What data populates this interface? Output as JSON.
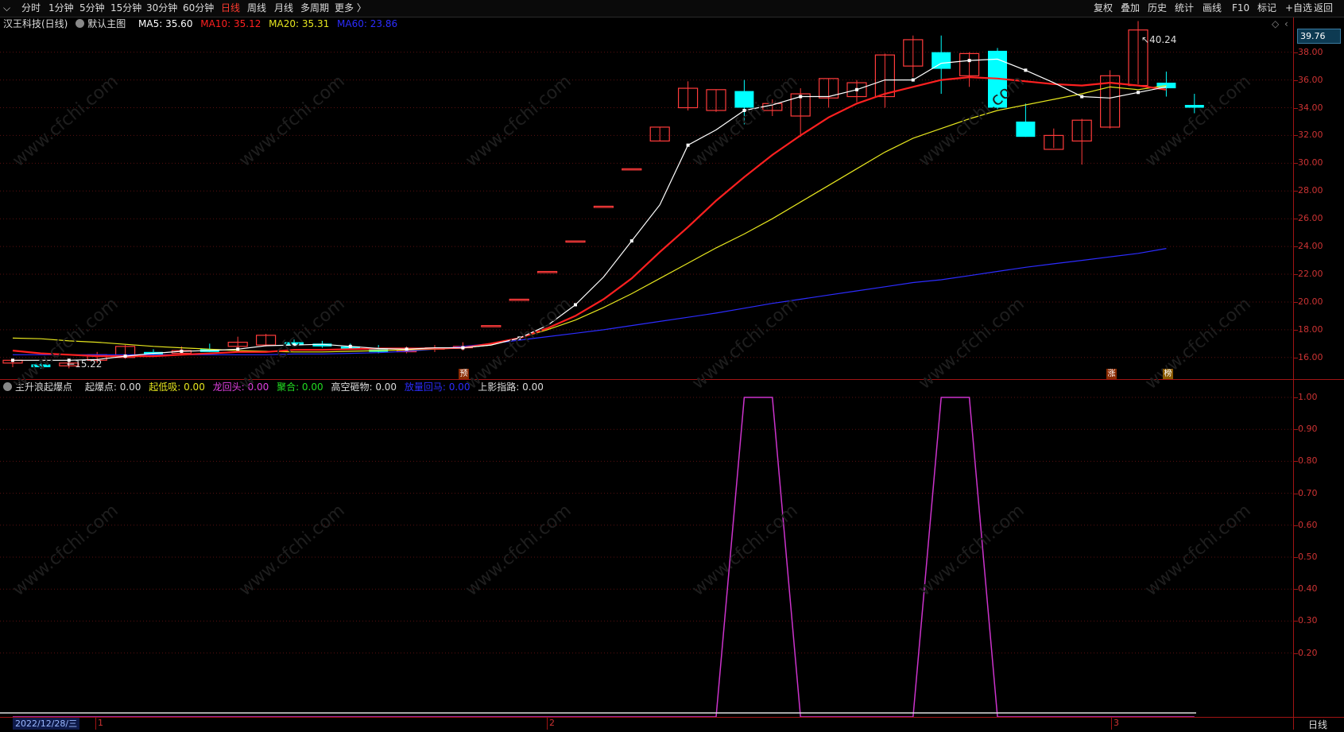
{
  "topbar": {
    "left_items": [
      "分时",
      "1分钟",
      "5分钟",
      "15分钟",
      "30分钟",
      "60分钟",
      "日线",
      "周线",
      "月线",
      "多周期",
      "更多 〉"
    ],
    "active_index": 6,
    "right_items": [
      "复权",
      "叠加",
      "历史",
      "统计",
      "画线",
      "F10",
      "标记",
      "+自选",
      "返回"
    ]
  },
  "main_legend": {
    "stock": "汉王科技(日线)",
    "template": "默认主图",
    "ma5": "MA5: 35.60",
    "ma10": "MA10: 35.12",
    "ma20": "MA20: 35.31",
    "ma60": "MA60: 23.86"
  },
  "indicator_legend": {
    "name": "主升浪起爆点",
    "items": [
      "起爆点: 0.00",
      "起低吸: 0.00",
      "龙回头: 0.00",
      "聚合: 0.00",
      "高空砸物: 0.00",
      "放量回马: 0.00",
      "上影指路: 0.00"
    ]
  },
  "colors": {
    "ma5": "#ffffff",
    "ma10": "#ff2020",
    "ma20": "#e6e61e",
    "ma60": "#2c2cff",
    "up": "#ff3b3b",
    "down": "#00ffff",
    "indicator": "#cc33cc",
    "grid": "#a01414"
  },
  "price_axis": {
    "current": "39.76",
    "ticks": [
      "38.00",
      "36.00",
      "34.00",
      "32.00",
      "30.00",
      "28.00",
      "26.00",
      "24.00",
      "22.00",
      "20.00",
      "18.00",
      "16.00"
    ]
  },
  "indicator_axis": {
    "ticks": [
      "1.00",
      "0.90",
      "0.80",
      "0.70",
      "0.60",
      "0.50",
      "0.40",
      "0.30",
      "0.20"
    ]
  },
  "annotations": {
    "high": "40.24",
    "low": "15.22",
    "badge_yu": "预",
    "badge_zhang": "涨",
    "badge_bang": "榜"
  },
  "bottom": {
    "date": "2022/12/28/三",
    "marks": [
      "1",
      "2",
      "3"
    ],
    "period": "日线"
  },
  "watermark": "www.cfchi.com",
  "chart_data": {
    "type": "candlestick",
    "ylim": [
      14.5,
      40.5
    ],
    "ohlc": [
      [
        15.6,
        15.9,
        15.3,
        15.8
      ],
      [
        15.5,
        15.8,
        15.2,
        15.3
      ],
      [
        15.4,
        15.7,
        15.22,
        15.6
      ],
      [
        15.8,
        16.4,
        15.6,
        16.2
      ],
      [
        16.0,
        16.9,
        15.9,
        16.8
      ],
      [
        16.4,
        16.6,
        16.1,
        16.2
      ],
      [
        16.3,
        16.8,
        16.2,
        16.5
      ],
      [
        16.6,
        17.0,
        16.4,
        16.4
      ],
      [
        16.8,
        17.5,
        16.6,
        17.1
      ],
      [
        16.9,
        17.7,
        16.8,
        17.6
      ],
      [
        17.1,
        17.3,
        16.8,
        16.9
      ],
      [
        17.0,
        17.2,
        16.7,
        16.8
      ],
      [
        16.8,
        17.0,
        16.6,
        16.6
      ],
      [
        16.6,
        16.9,
        16.3,
        16.4
      ],
      [
        16.5,
        16.8,
        16.3,
        16.5
      ],
      [
        16.6,
        16.9,
        16.4,
        16.7
      ],
      [
        16.7,
        17.1,
        16.5,
        16.8
      ],
      [
        18.3,
        18.3,
        18.3,
        18.3
      ],
      [
        20.2,
        20.2,
        20.2,
        20.2
      ],
      [
        22.2,
        22.2,
        22.2,
        22.2
      ],
      [
        24.4,
        24.4,
        24.4,
        24.4
      ],
      [
        26.9,
        26.9,
        26.9,
        26.9
      ],
      [
        29.6,
        29.6,
        29.6,
        29.6
      ],
      [
        31.6,
        32.6,
        31.6,
        32.6
      ],
      [
        34.0,
        35.9,
        33.8,
        35.4
      ],
      [
        33.8,
        35.3,
        33.7,
        35.3
      ],
      [
        35.2,
        36.0,
        32.8,
        34.0
      ],
      [
        33.8,
        34.6,
        33.4,
        34.3
      ],
      [
        33.4,
        35.4,
        31.9,
        35.0
      ],
      [
        34.7,
        36.1,
        34.0,
        36.1
      ],
      [
        34.8,
        36.0,
        34.4,
        35.8
      ],
      [
        34.8,
        37.9,
        34.0,
        37.8
      ],
      [
        37.0,
        39.2,
        36.2,
        38.9
      ],
      [
        38.0,
        39.2,
        35.0,
        36.8
      ],
      [
        36.3,
        38.0,
        35.5,
        37.9
      ],
      [
        38.1,
        38.3,
        33.9,
        34.0
      ],
      [
        33.0,
        34.3,
        31.9,
        31.9
      ],
      [
        31.0,
        32.5,
        31.1,
        32.0
      ],
      [
        31.6,
        33.2,
        29.9,
        33.1
      ],
      [
        32.6,
        36.7,
        32.5,
        36.3
      ],
      [
        35.6,
        40.24,
        35.7,
        39.6
      ],
      [
        35.8,
        36.6,
        34.8,
        35.4
      ],
      [
        34.2,
        35.0,
        33.6,
        34.0
      ]
    ],
    "ma5": [
      15.8,
      15.8,
      15.8,
      15.85,
      16.1,
      16.3,
      16.45,
      16.5,
      16.6,
      16.85,
      16.9,
      16.95,
      16.8,
      16.65,
      16.6,
      16.7,
      16.7,
      16.9,
      17.4,
      18.3,
      19.8,
      21.8,
      24.4,
      27.0,
      31.3,
      32.4,
      33.8,
      34.2,
      34.8,
      34.8,
      35.3,
      36.0,
      36.0,
      37.2,
      37.4,
      37.5,
      36.7,
      35.8,
      34.8,
      34.7,
      35.1,
      35.5
    ],
    "ma10": [
      16.5,
      16.3,
      16.2,
      16.1,
      16.1,
      16.1,
      16.2,
      16.3,
      16.4,
      16.4,
      16.55,
      16.55,
      16.6,
      16.65,
      16.65,
      16.65,
      16.7,
      17.0,
      17.4,
      18.1,
      19.0,
      20.2,
      21.7,
      23.6,
      25.4,
      27.3,
      29.0,
      30.6,
      32.0,
      33.3,
      34.3,
      35.0,
      35.5,
      36.0,
      36.2,
      36.1,
      35.9,
      35.7,
      35.6,
      35.8,
      35.6,
      35.3
    ],
    "ma20": [
      17.4,
      17.35,
      17.2,
      17.1,
      16.95,
      16.8,
      16.7,
      16.6,
      16.5,
      16.45,
      16.4,
      16.4,
      16.45,
      16.5,
      16.55,
      16.6,
      16.7,
      16.9,
      17.4,
      18.0,
      18.7,
      19.6,
      20.6,
      21.7,
      22.8,
      23.9,
      24.9,
      26.0,
      27.2,
      28.4,
      29.6,
      30.8,
      31.8,
      32.5,
      33.2,
      33.8,
      34.2,
      34.6,
      35.0,
      35.5,
      35.3,
      35.6
    ],
    "ma60": [
      16.2,
      16.2,
      16.2,
      16.2,
      16.2,
      16.2,
      16.2,
      16.2,
      16.2,
      16.2,
      16.25,
      16.25,
      16.3,
      16.35,
      16.45,
      16.6,
      16.8,
      17.0,
      17.25,
      17.5,
      17.75,
      18.0,
      18.3,
      18.6,
      18.9,
      19.2,
      19.55,
      19.9,
      20.2,
      20.5,
      20.8,
      21.1,
      21.4,
      21.6,
      21.9,
      22.2,
      22.5,
      22.75,
      23.0,
      23.25,
      23.5,
      23.86
    ],
    "indicator": [
      0,
      0,
      0,
      0,
      0,
      0,
      0,
      0,
      0,
      0,
      0,
      0,
      0,
      0,
      0,
      0,
      0,
      0,
      0,
      0,
      0,
      0,
      0,
      0,
      0,
      0,
      1,
      1,
      0,
      0,
      0,
      0,
      0,
      1,
      1,
      0,
      0,
      0,
      0,
      0,
      0,
      0,
      0
    ]
  }
}
